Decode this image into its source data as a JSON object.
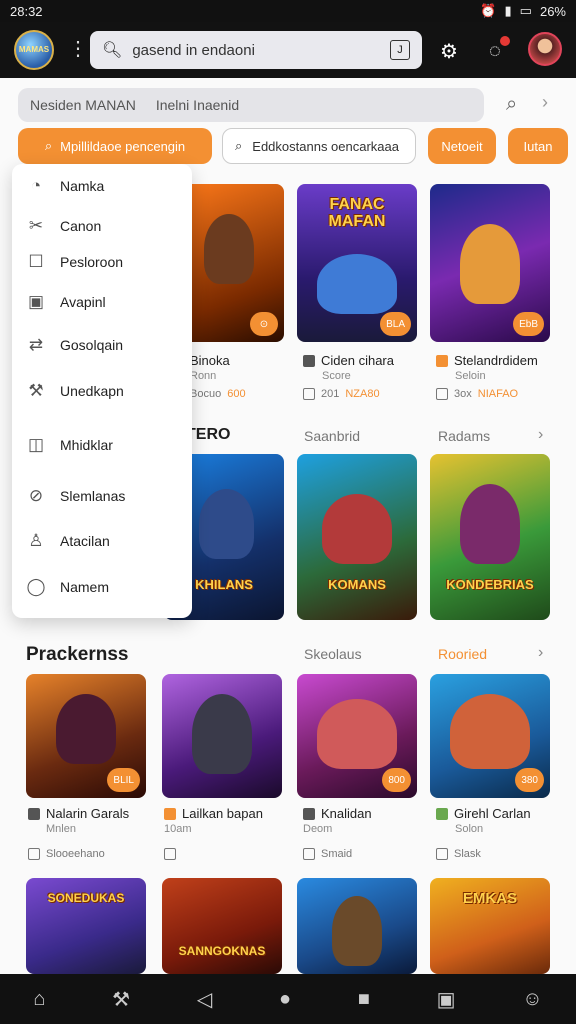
{
  "status": {
    "time": "28:32",
    "battery": "26%"
  },
  "topbar": {
    "logo_text": "MAMAS",
    "search_value": "gasend in endaoni",
    "search_kbd": "J"
  },
  "filter": {
    "text_left": "Nesiden MANAN",
    "text_right": "Inelni Inaenid"
  },
  "buttons": {
    "primary": "Mpillildaoe pencengin",
    "chip": "Eddkostanns oencarkaaa",
    "btn1": "Netoeit",
    "btn2": "Iutan"
  },
  "menu": {
    "items": [
      {
        "label": "Namka",
        "icon": "clock-icon"
      },
      {
        "label": "Canon",
        "icon": "tool-icon"
      },
      {
        "label": "Pesloroon",
        "icon": "square-icon"
      },
      {
        "label": "Avapinl",
        "icon": "image-icon"
      },
      {
        "label": "Gosolqain",
        "icon": "sync-icon"
      },
      {
        "label": "Unedkapn",
        "icon": "hammer-icon"
      },
      {
        "label": "Mhidklar",
        "icon": "panel-icon"
      },
      {
        "label": "Slemlanas",
        "icon": "compass-icon"
      },
      {
        "label": "Atacilan",
        "icon": "user-icon"
      },
      {
        "label": "Namem",
        "icon": "chat-icon"
      }
    ]
  },
  "row1": [
    {
      "art_title": "",
      "badge": "",
      "title": "Binoka",
      "sub": "Ronn",
      "foot_label": "Bocuo",
      "foot_val": "600"
    },
    {
      "art_title": "FANAC MAFAN",
      "badge": "BLA",
      "title": "Ciden cihara",
      "sub": "Score",
      "foot_label": "201",
      "foot_val": "NZA80"
    },
    {
      "art_title": "",
      "badge": "EbB",
      "title": "Stelandrdidem",
      "sub": "Seloin",
      "foot_label": "3ox",
      "foot_val": "NIAFAO"
    }
  ],
  "section1": {
    "title": "TERO",
    "link1": "Saanbrid",
    "link2": "Radams"
  },
  "row2": [
    {
      "art_title": "KHILANS",
      "badge": ""
    },
    {
      "art_title": "KOMANS",
      "badge": ""
    },
    {
      "art_title": "KONDEBRIAS",
      "badge": ""
    }
  ],
  "section2": {
    "title": "Prackernss",
    "link1": "Skeolaus",
    "link2": "Rooried"
  },
  "row3": [
    {
      "badge": "BLIL",
      "title": "Nalarin Garals",
      "sub": "Mnlen",
      "foot": "Slooeehano"
    },
    {
      "badge": "",
      "title": "Lailkan bapan",
      "sub": "10am",
      "foot": ""
    },
    {
      "badge": "800",
      "title": "Knalidan",
      "sub": "Deom",
      "foot": "Smaid"
    },
    {
      "badge": "380",
      "title": "Girehl Carlan",
      "sub": "Solon",
      "foot": "Slask"
    }
  ],
  "row4": [
    {
      "art_title": "SONEDUKAS"
    },
    {
      "art_title": "SANNGOKNAS"
    },
    {
      "art_title": ""
    },
    {
      "art_title": "EMKAS"
    }
  ],
  "colors": {
    "accent": "#f39033",
    "topbar": "#121212"
  }
}
